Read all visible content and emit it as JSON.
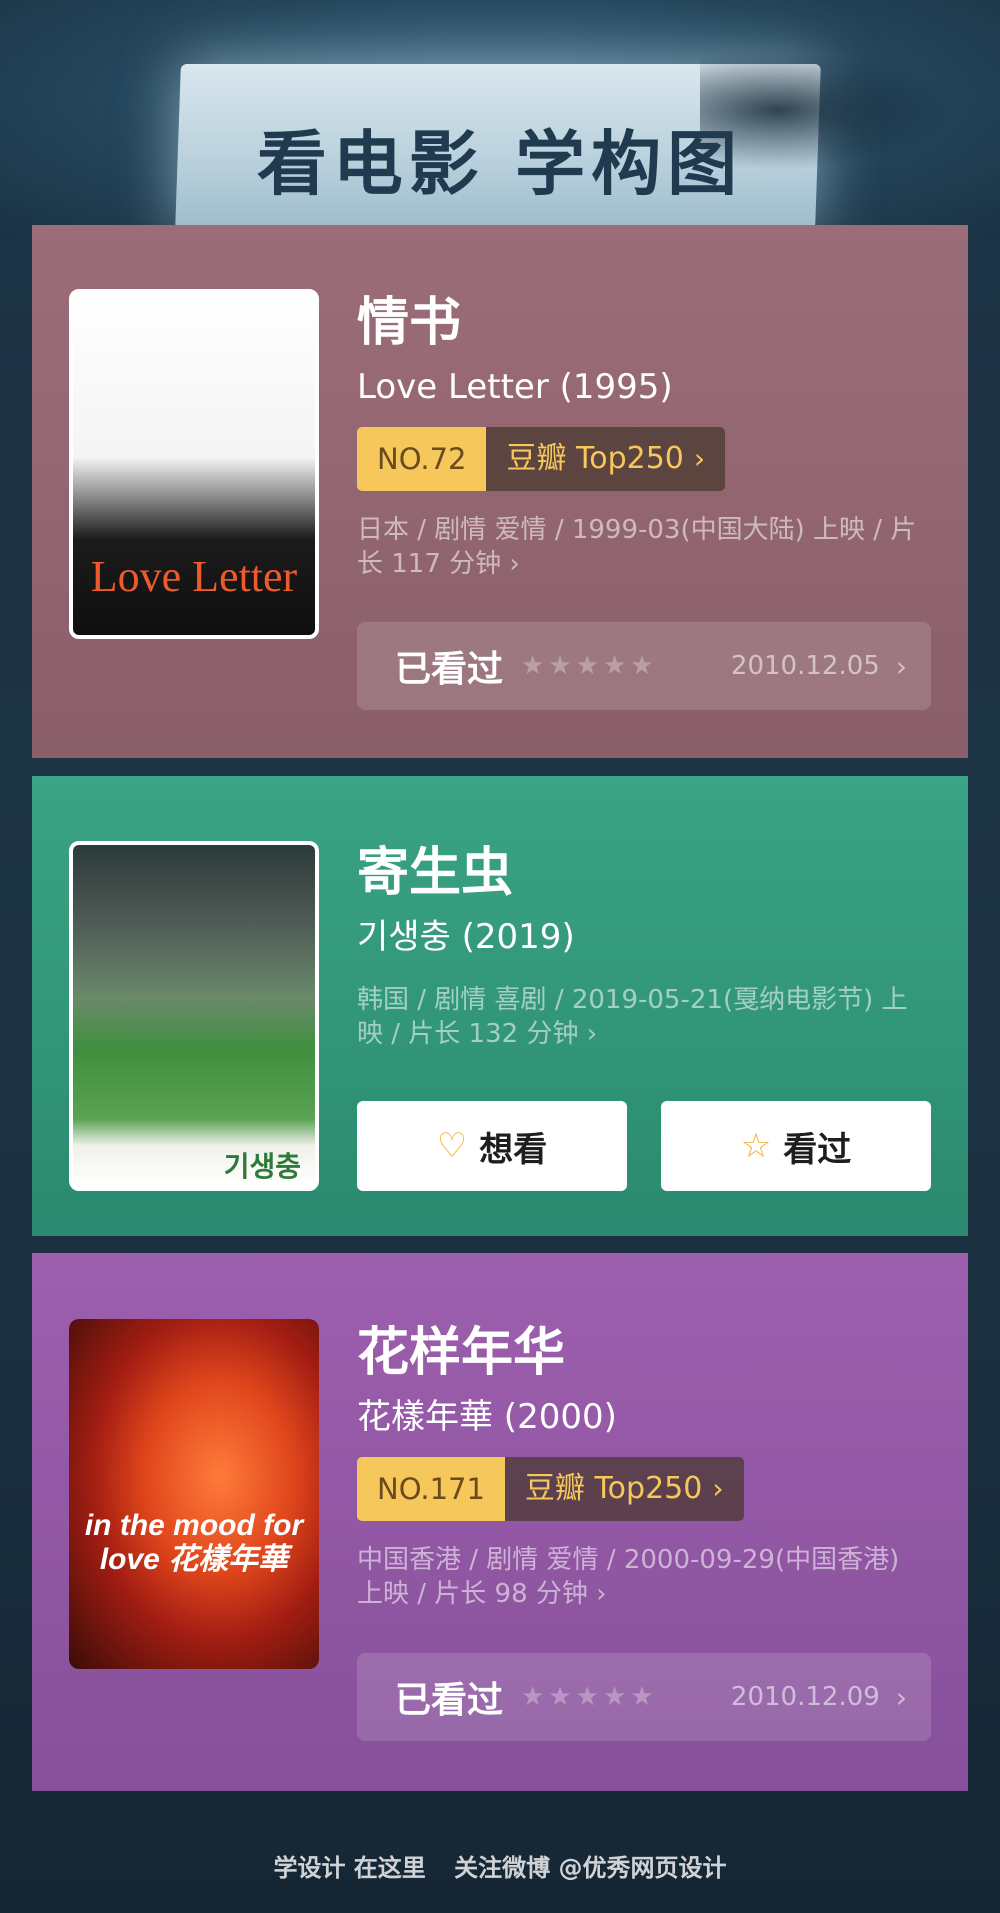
{
  "header": {
    "title": "看电影 学构图"
  },
  "movies": [
    {
      "title": "情书",
      "original_title": "Love Letter (1995)",
      "poster_caption": "Love Letter",
      "rank_no": "NO.72",
      "rank_list": "豆瓣 Top250",
      "meta": "日本 / 剧情 爱情 / 1999-03(中国大陆) 上映 / 片长 117 分钟 ›",
      "status_label": "已看过",
      "watched_date": "2010.12.05",
      "color": "#8f6470"
    },
    {
      "title": "寄生虫",
      "original_title": "기생충 (2019)",
      "poster_caption": "기생충",
      "meta": "韩国 / 剧情 喜剧 / 2019-05-21(戛纳电影节) 上映 / 片长 132 分钟 ›",
      "want_label": "想看",
      "seen_label": "看过",
      "color": "#309577"
    },
    {
      "title": "花样年华",
      "original_title": "花樣年華 (2000)",
      "poster_caption": "in the mood for love 花樣年華",
      "rank_no": "NO.171",
      "rank_list": "豆瓣 Top250",
      "meta": "中国香港 / 剧情 爱情 / 2000-09-29(中国香港) 上映 / 片长 98 分钟 ›",
      "status_label": "已看过",
      "watched_date": "2010.12.09",
      "color": "#9156a4"
    }
  ],
  "footer": {
    "left": "学设计 在这里",
    "right": "关注微博 @优秀网页设计"
  },
  "icons": {
    "chevron": "chevron-right-icon",
    "star": "star-icon",
    "heart_plus": "heart-plus-icon"
  }
}
